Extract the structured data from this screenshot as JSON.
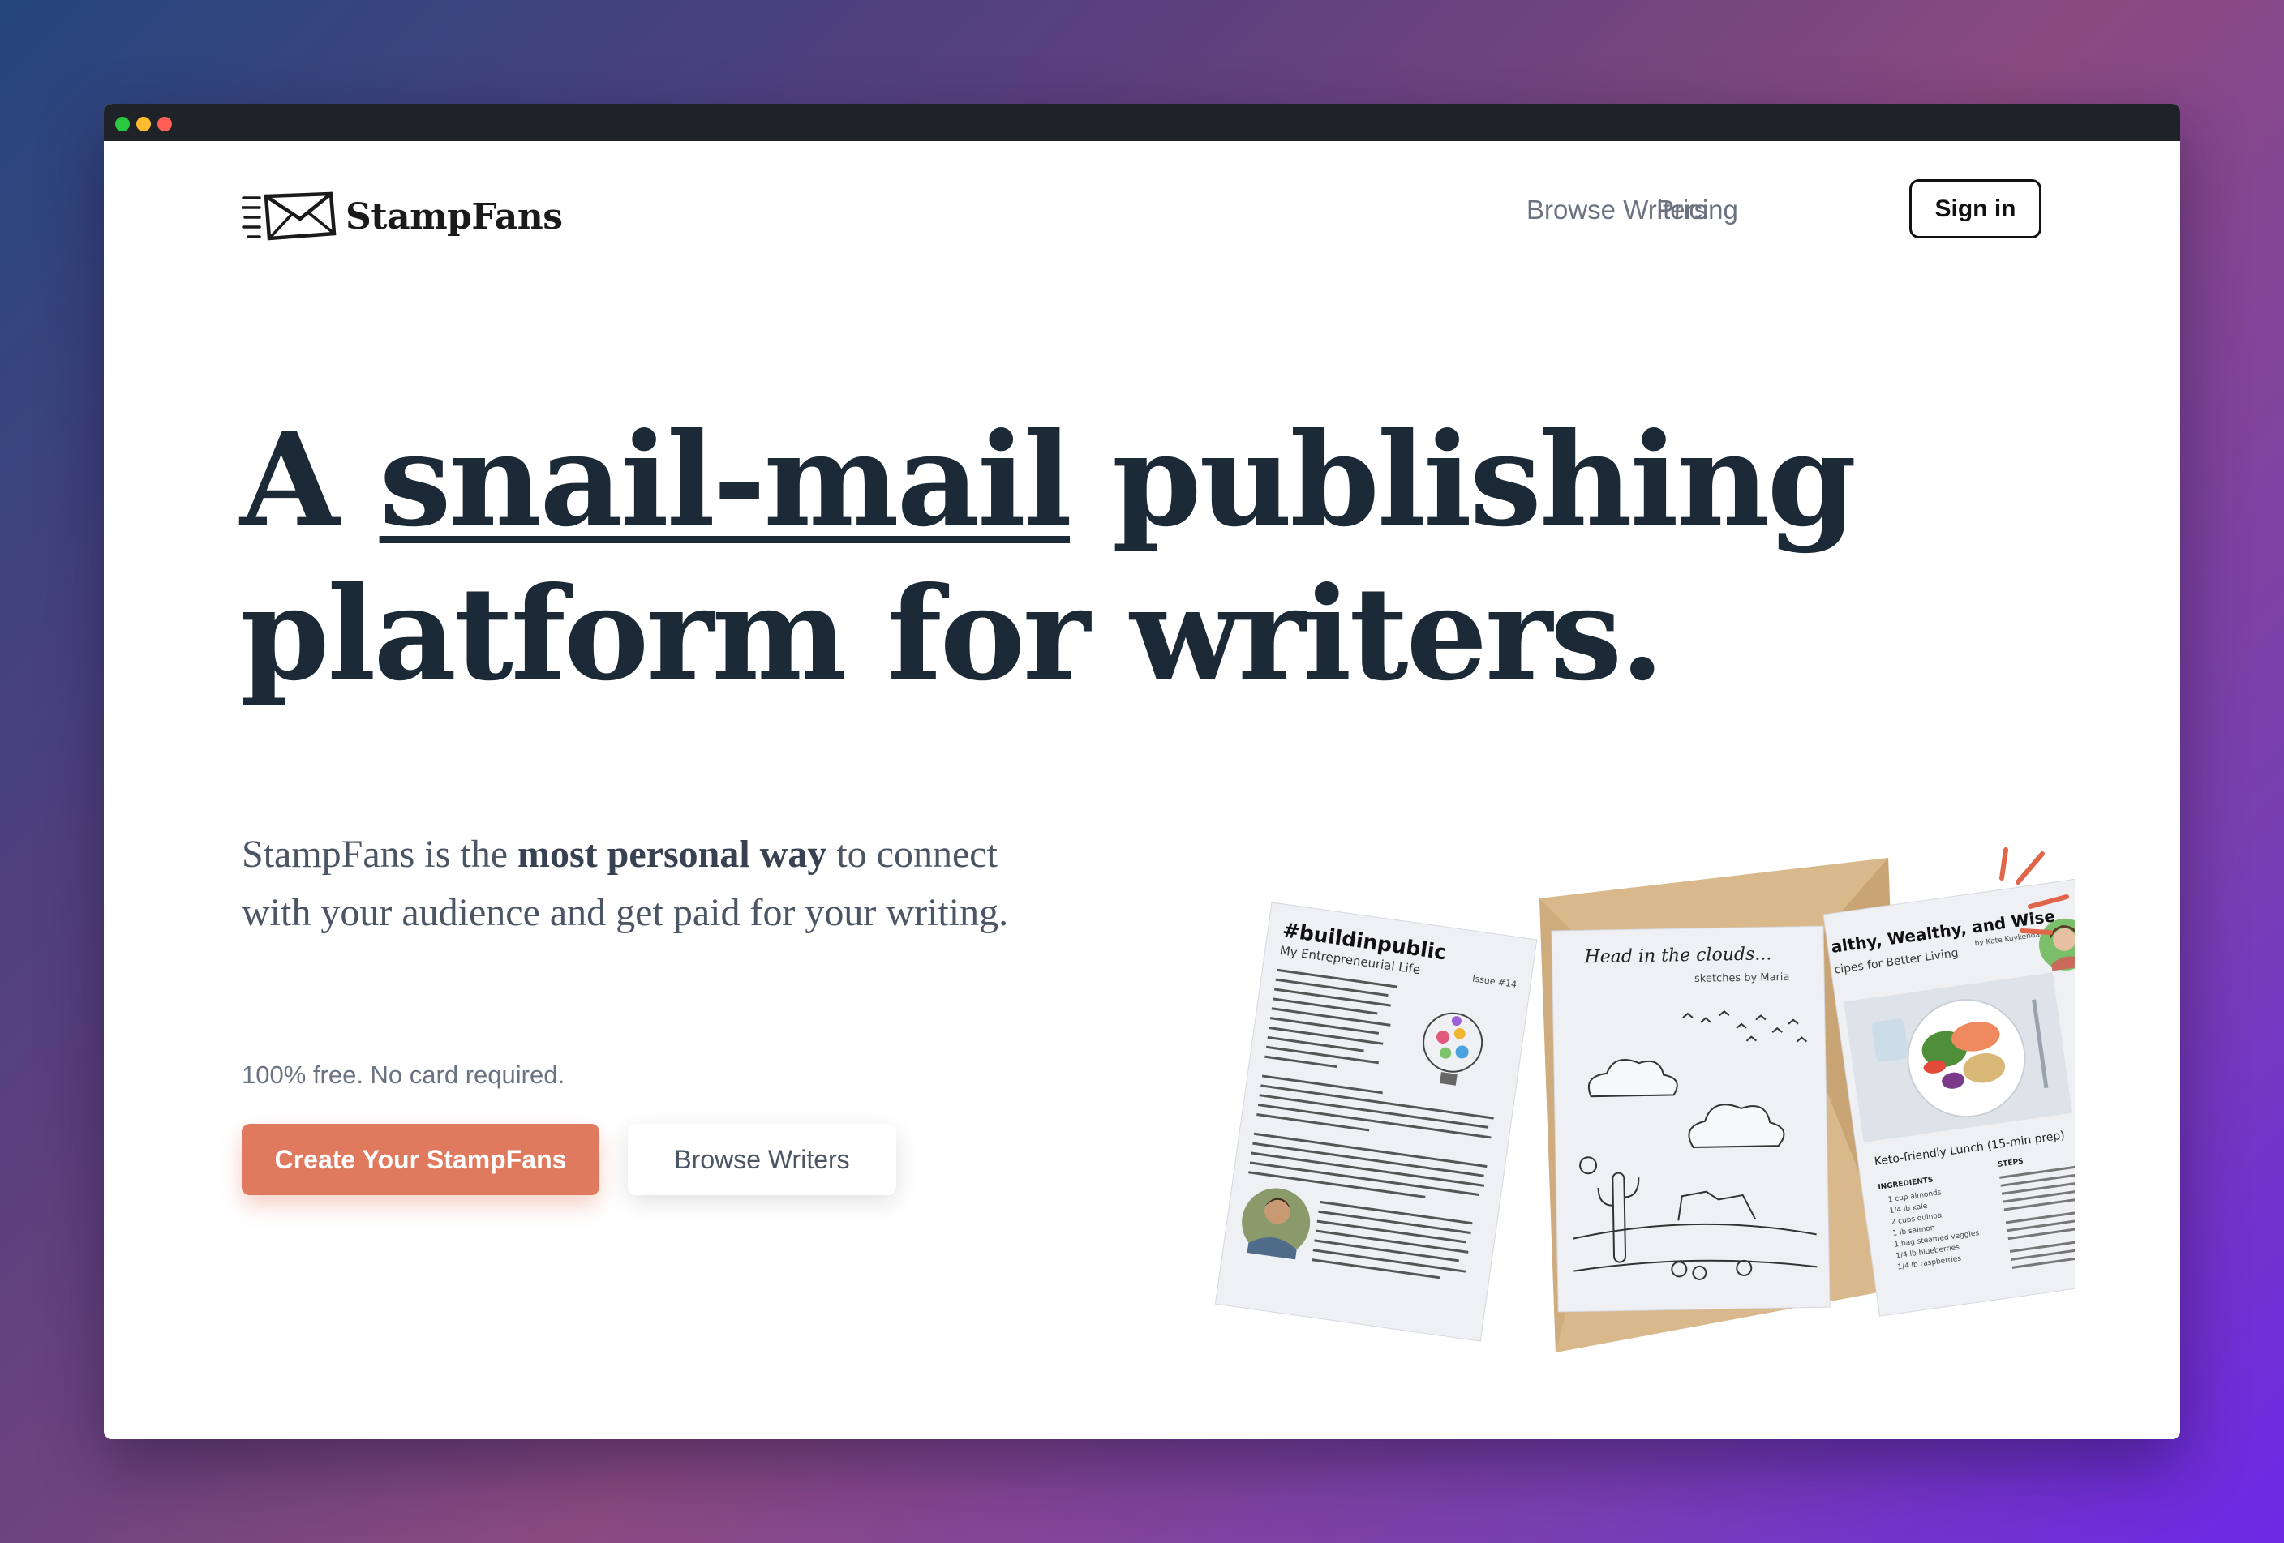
{
  "brand": {
    "name": "StampFans"
  },
  "nav": {
    "browse_writers": "Browse Writers",
    "pricing": "Pricing",
    "sign_in": "Sign in"
  },
  "hero": {
    "headline_pre": "A ",
    "headline_underlined": "snail-mail",
    "headline_line1_post": " publishing",
    "headline_line2": "platform for writers.",
    "intro_pre": "StampFans is the ",
    "intro_bold": "most personal way",
    "intro_post": " to connect with your audience and get paid for your writing.",
    "fine_print": "100% free. No card required.",
    "cta_primary": "Create Your StampFans",
    "cta_secondary": "Browse Writers"
  },
  "illustration": {
    "card1": {
      "title": "#buildinpublic",
      "subtitle": "My Entrepreneurial Life",
      "issue": "Issue #14"
    },
    "card2": {
      "title": "Head in the clouds...",
      "subtitle": "sketches by Maria"
    },
    "card3": {
      "title": "althy, Wealthy, and Wise",
      "byline": "by Kate Kuykendall",
      "subtitle": "cipes for Better Living",
      "caption": "Keto-friendly Lunch (15-min prep)",
      "ingredients_heading": "INGREDIENTS",
      "steps_heading": "STEPS",
      "ingredients": [
        "1 cup almonds",
        "1/4 lb kale",
        "2 cups quinoa",
        "1 lb salmon",
        "1 bag steamed veggies",
        "1/4 lb blueberries",
        "1/4 lb raspberries"
      ]
    }
  },
  "colors": {
    "accent": "#e07a5f",
    "headline": "#1b2a36",
    "envelope": "#d9b88c"
  }
}
